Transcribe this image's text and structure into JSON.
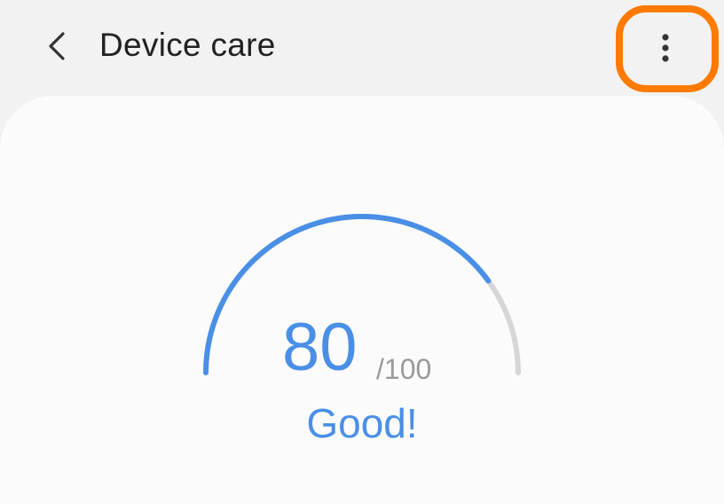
{
  "header": {
    "title": "Device care",
    "back_icon": "chevron-left-icon",
    "more_icon": "more-vertical-icon",
    "highlight_color": "#ff7a00"
  },
  "score_card": {
    "score": "80",
    "max": "/100",
    "status": "Good!",
    "progress_fraction": 0.8,
    "accent_color": "#4a8fe6",
    "track_color": "#d6d6d6"
  }
}
